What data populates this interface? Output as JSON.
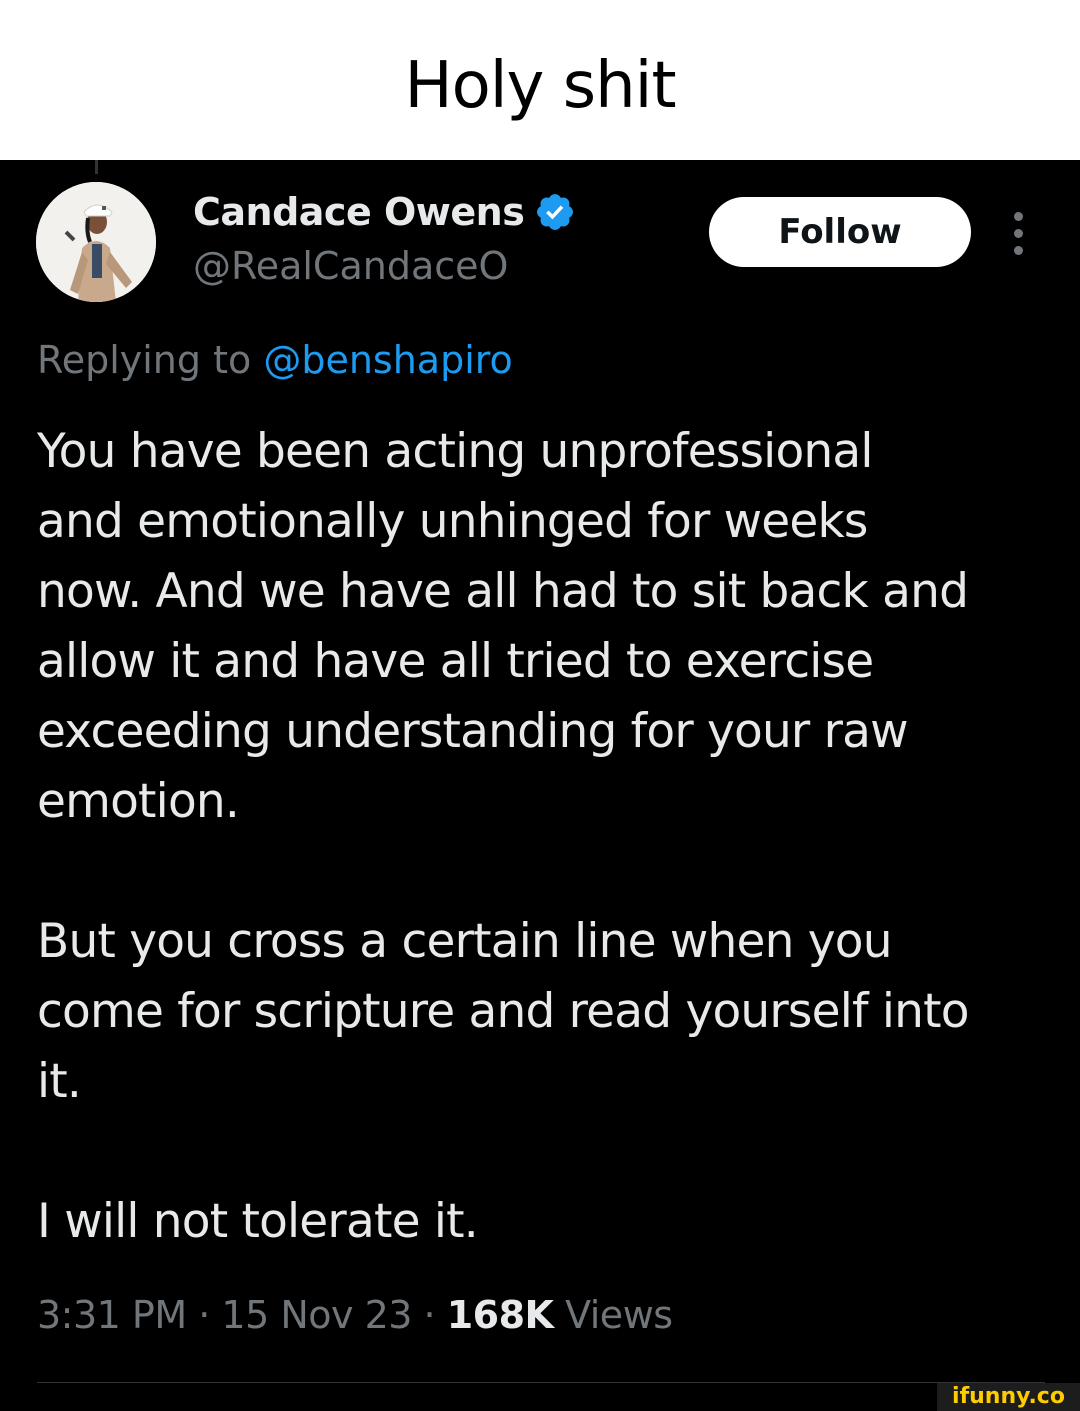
{
  "caption": "Holy shit",
  "tweet": {
    "author": {
      "display_name": "Candace Owens",
      "handle": "@RealCandaceO",
      "verified": true
    },
    "follow_label": "Follow",
    "reply": {
      "prefix": "Replying to",
      "mention": "@benshapiro"
    },
    "paragraphs": [
      "You have been acting unprofessional\nand emotionally unhinged  for weeks\nnow. And we have all had to sit back and\nallow it and have all tried to exercise\nexceeding understanding for your raw\nemotion.",
      "But you cross a certain line when you\ncome for scripture and read yourself into\nit.",
      "I will not tolerate it."
    ],
    "meta": {
      "time": "3:31 PM",
      "separator": "·",
      "date": "15 Nov 23",
      "views_count": "168K",
      "views_label": "Views"
    }
  },
  "watermark": "ifunny.co",
  "colors": {
    "background": "#000000",
    "text": "#e7e9ea",
    "secondary": "#71767b",
    "accent": "#1d9bf0"
  },
  "icons": {
    "verified": "verified-badge-icon",
    "more": "more-vertical-icon"
  }
}
